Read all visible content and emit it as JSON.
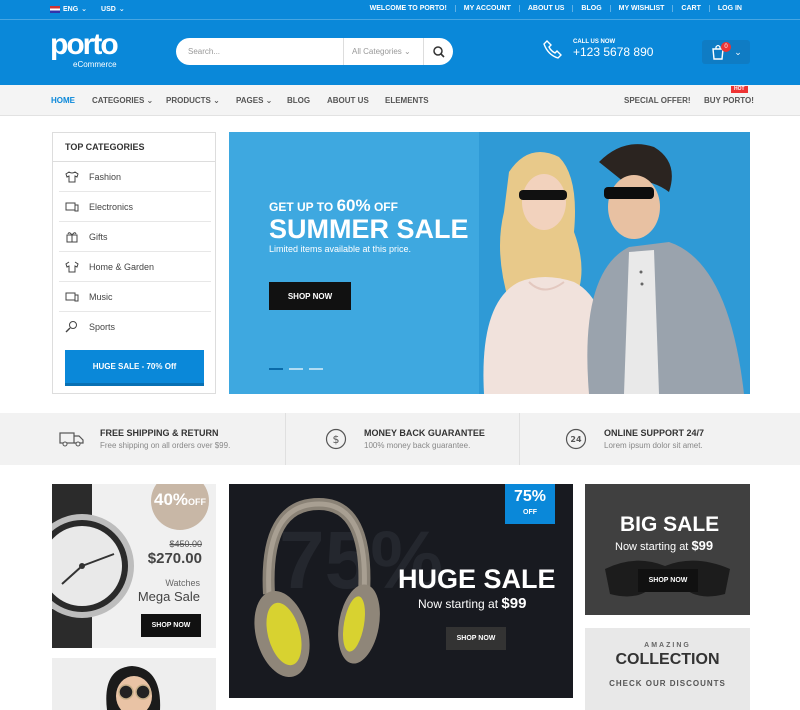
{
  "topbar": {
    "language": "ENG",
    "currency": "USD",
    "links": [
      "WELCOME TO PORTO!",
      "MY ACCOUNT",
      "ABOUT US",
      "BLOG",
      "MY WISHLIST",
      "CART",
      "LOG IN"
    ]
  },
  "header": {
    "logo_main": "porto",
    "logo_sub": "eCommerce",
    "search_placeholder": "Search...",
    "search_category": "All Categories",
    "call_label": "CALL US NOW",
    "call_number": "+123 5678 890",
    "cart_count": "0"
  },
  "nav": {
    "items": [
      "HOME",
      "CATEGORIES",
      "PRODUCTS",
      "PAGES",
      "BLOG",
      "ABOUT US",
      "ELEMENTS"
    ],
    "special": "SPECIAL OFFER!",
    "buy": "BUY PORTO!",
    "hot": "HOT"
  },
  "categories": {
    "title": "TOP CATEGORIES",
    "items": [
      {
        "label": "Fashion",
        "icon": "tshirt-icon"
      },
      {
        "label": "Electronics",
        "icon": "electronics-icon"
      },
      {
        "label": "Gifts",
        "icon": "gift-icon"
      },
      {
        "label": "Home & Garden",
        "icon": "home-garden-icon"
      },
      {
        "label": "Music",
        "icon": "music-icon"
      },
      {
        "label": "Sports",
        "icon": "sports-icon"
      }
    ],
    "sale_button": "HUGE SALE - 70% Off"
  },
  "hero": {
    "line1_prefix": "GET UP TO",
    "line1_percent": "60%",
    "line1_suffix": "OFF",
    "title": "SUMMER SALE",
    "subtitle": "Limited items available at this price.",
    "button": "SHOP NOW"
  },
  "features": [
    {
      "title": "FREE SHIPPING & RETURN",
      "text": "Free shipping on all orders over $99.",
      "icon": "truck-icon"
    },
    {
      "title": "MONEY BACK GUARANTEE",
      "text": "100% money back guarantee.",
      "icon": "dollar-icon"
    },
    {
      "title": "ONLINE SUPPORT 24/7",
      "text": "Lorem ipsum dolor sit amet.",
      "icon": "support-24-icon"
    }
  ],
  "banner_watch": {
    "discount": "40%",
    "discount_suffix": "OFF",
    "old_price": "$450.00",
    "new_price": "$270.00",
    "label1": "Watches",
    "label2": "Mega Sale",
    "button": "SHOP NOW"
  },
  "banner_headphones": {
    "bg_number": "75%",
    "ribbon": "75%",
    "ribbon_sub": "OFF",
    "title": "HUGE SALE",
    "subtitle_prefix": "Now starting at",
    "price": "$99",
    "button": "SHOP NOW"
  },
  "banner_bigsale": {
    "title": "BIG SALE",
    "subtitle_prefix": "Now starting at",
    "price": "$99",
    "button": "SHOP NOW"
  },
  "banner_collection": {
    "top": "AMAZING",
    "title": "COLLECTION",
    "bottom": "CHECK OUR DISCOUNTS"
  },
  "colors": {
    "primary": "#0a88d9",
    "hot": "#e33333",
    "dark": "#111111"
  }
}
